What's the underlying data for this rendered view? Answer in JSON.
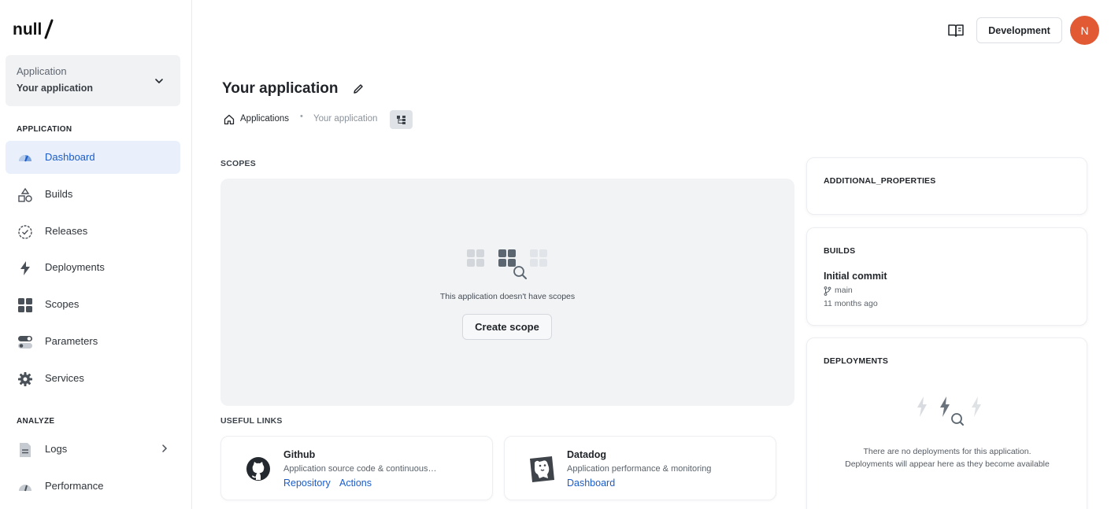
{
  "sidebar": {
    "logo_text": "null",
    "app_selector": {
      "label": "Application",
      "value": "Your application"
    },
    "section_application": "APPLICATION",
    "items": [
      {
        "label": "Dashboard",
        "icon": "dashboard-gauge-icon"
      },
      {
        "label": "Builds",
        "icon": "shapes-icon"
      },
      {
        "label": "Releases",
        "icon": "badge-check-icon"
      },
      {
        "label": "Deployments",
        "icon": "lightning-icon"
      },
      {
        "label": "Scopes",
        "icon": "grid-icon"
      },
      {
        "label": "Parameters",
        "icon": "toggles-icon"
      },
      {
        "label": "Services",
        "icon": "gear-icon"
      }
    ],
    "section_analyze": "ANALYZE",
    "analyze_items": [
      {
        "label": "Logs",
        "icon": "document-icon"
      },
      {
        "label": "Performance",
        "icon": "gauge-icon"
      }
    ]
  },
  "topbar": {
    "docs_icon": "book-icon",
    "environment": "Development",
    "avatar_initial": "N",
    "avatar_color": "#e25a33"
  },
  "header": {
    "title": "Your application",
    "breadcrumb": {
      "root": "Applications",
      "current": "Your application"
    }
  },
  "scopes": {
    "section_label": "SCOPES",
    "empty_text": "This application doesn't have scopes",
    "create_button": "Create scope"
  },
  "useful_links": {
    "section_label": "USEFUL LINKS",
    "cards": [
      {
        "title": "Github",
        "description": "Application source code & continuous…",
        "links": [
          "Repository",
          "Actions"
        ],
        "icon": "github-icon"
      },
      {
        "title": "Datadog",
        "description": "Application performance & monitoring",
        "links": [
          "Dashboard"
        ],
        "icon": "datadog-icon"
      }
    ]
  },
  "right_panel": {
    "additional_properties_label": "ADDITIONAL_PROPERTIES",
    "builds": {
      "label": "BUILDS",
      "latest": {
        "title": "Initial commit",
        "branch": "main",
        "time": "11 months ago"
      }
    },
    "deployments": {
      "label": "DEPLOYMENTS",
      "empty_text": "There are no deployments for this application. Deployments will appear here as they become available"
    }
  },
  "colors": {
    "accent": "#1b5cc9",
    "active_bg": "#e9f0fb",
    "panel_bg": "#f2f3f5"
  }
}
